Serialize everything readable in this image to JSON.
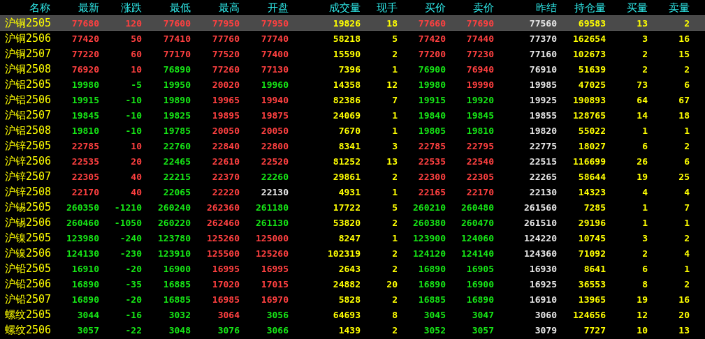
{
  "table": {
    "columns": [
      {
        "label": "名称",
        "kind": "name"
      },
      {
        "label": "最新",
        "kind": "price"
      },
      {
        "label": "涨跌",
        "kind": "price"
      },
      {
        "label": "最低",
        "kind": "price"
      },
      {
        "label": "最高",
        "kind": "price"
      },
      {
        "label": "开盘",
        "kind": "price"
      },
      {
        "label": "成交量",
        "kind": "volume"
      },
      {
        "label": "现手",
        "kind": "volume"
      },
      {
        "label": "买价",
        "kind": "price"
      },
      {
        "label": "卖价",
        "kind": "price"
      },
      {
        "label": "昨结",
        "kind": "settle"
      },
      {
        "label": "持仓量",
        "kind": "volume"
      },
      {
        "label": "买量",
        "kind": "volume"
      },
      {
        "label": "卖量",
        "kind": "volume"
      }
    ],
    "rows": [
      {
        "selected": true,
        "cells": [
          {
            "text": "沪铜2505"
          },
          {
            "text": "77680",
            "color": "#ff4040"
          },
          {
            "text": "120",
            "color": "#ff4040"
          },
          {
            "text": "77600",
            "color": "#ff4040"
          },
          {
            "text": "77950",
            "color": "#ff4040"
          },
          {
            "text": "77950",
            "color": "#ff4040"
          },
          {
            "text": "19826"
          },
          {
            "text": "18"
          },
          {
            "text": "77660",
            "color": "#ff4040"
          },
          {
            "text": "77690",
            "color": "#ff4040"
          },
          {
            "text": "77560"
          },
          {
            "text": "69583"
          },
          {
            "text": "13"
          },
          {
            "text": "2"
          }
        ]
      },
      {
        "selected": false,
        "cells": [
          {
            "text": "沪铜2506"
          },
          {
            "text": "77420",
            "color": "#ff4040"
          },
          {
            "text": "50",
            "color": "#ff4040"
          },
          {
            "text": "77410",
            "color": "#ff4040"
          },
          {
            "text": "77760",
            "color": "#ff4040"
          },
          {
            "text": "77740",
            "color": "#ff4040"
          },
          {
            "text": "58218"
          },
          {
            "text": "5"
          },
          {
            "text": "77420",
            "color": "#ff4040"
          },
          {
            "text": "77440",
            "color": "#ff4040"
          },
          {
            "text": "77370"
          },
          {
            "text": "162654"
          },
          {
            "text": "3"
          },
          {
            "text": "16"
          }
        ]
      },
      {
        "selected": false,
        "cells": [
          {
            "text": "沪铜2507"
          },
          {
            "text": "77220",
            "color": "#ff4040"
          },
          {
            "text": "60",
            "color": "#ff4040"
          },
          {
            "text": "77170",
            "color": "#ff4040"
          },
          {
            "text": "77520",
            "color": "#ff4040"
          },
          {
            "text": "77400",
            "color": "#ff4040"
          },
          {
            "text": "15590"
          },
          {
            "text": "2"
          },
          {
            "text": "77200",
            "color": "#ff4040"
          },
          {
            "text": "77230",
            "color": "#ff4040"
          },
          {
            "text": "77160"
          },
          {
            "text": "102673"
          },
          {
            "text": "2"
          },
          {
            "text": "15"
          }
        ]
      },
      {
        "selected": false,
        "cells": [
          {
            "text": "沪铜2508"
          },
          {
            "text": "76920",
            "color": "#ff4040"
          },
          {
            "text": "10",
            "color": "#ff4040"
          },
          {
            "text": "76890",
            "color": "#16e616"
          },
          {
            "text": "77260",
            "color": "#ff4040"
          },
          {
            "text": "77130",
            "color": "#ff4040"
          },
          {
            "text": "7396"
          },
          {
            "text": "1"
          },
          {
            "text": "76900",
            "color": "#16e616"
          },
          {
            "text": "76940",
            "color": "#ff4040"
          },
          {
            "text": "76910"
          },
          {
            "text": "51639"
          },
          {
            "text": "2"
          },
          {
            "text": "2"
          }
        ]
      },
      {
        "selected": false,
        "cells": [
          {
            "text": "沪铝2505"
          },
          {
            "text": "19980",
            "color": "#16e616"
          },
          {
            "text": "-5",
            "color": "#16e616"
          },
          {
            "text": "19950",
            "color": "#16e616"
          },
          {
            "text": "20020",
            "color": "#ff4040"
          },
          {
            "text": "19960",
            "color": "#16e616"
          },
          {
            "text": "14358"
          },
          {
            "text": "12"
          },
          {
            "text": "19980",
            "color": "#16e616"
          },
          {
            "text": "19990",
            "color": "#ff4040"
          },
          {
            "text": "19985"
          },
          {
            "text": "47025"
          },
          {
            "text": "73"
          },
          {
            "text": "6"
          }
        ]
      },
      {
        "selected": false,
        "cells": [
          {
            "text": "沪铝2506"
          },
          {
            "text": "19915",
            "color": "#16e616"
          },
          {
            "text": "-10",
            "color": "#16e616"
          },
          {
            "text": "19890",
            "color": "#16e616"
          },
          {
            "text": "19965",
            "color": "#ff4040"
          },
          {
            "text": "19940",
            "color": "#ff4040"
          },
          {
            "text": "82386"
          },
          {
            "text": "7"
          },
          {
            "text": "19915",
            "color": "#16e616"
          },
          {
            "text": "19920",
            "color": "#16e616"
          },
          {
            "text": "19925"
          },
          {
            "text": "190893"
          },
          {
            "text": "64"
          },
          {
            "text": "67"
          }
        ]
      },
      {
        "selected": false,
        "cells": [
          {
            "text": "沪铝2507"
          },
          {
            "text": "19845",
            "color": "#16e616"
          },
          {
            "text": "-10",
            "color": "#16e616"
          },
          {
            "text": "19825",
            "color": "#16e616"
          },
          {
            "text": "19895",
            "color": "#ff4040"
          },
          {
            "text": "19875",
            "color": "#ff4040"
          },
          {
            "text": "24069"
          },
          {
            "text": "1"
          },
          {
            "text": "19840",
            "color": "#16e616"
          },
          {
            "text": "19845",
            "color": "#16e616"
          },
          {
            "text": "19855"
          },
          {
            "text": "128765"
          },
          {
            "text": "14"
          },
          {
            "text": "18"
          }
        ]
      },
      {
        "selected": false,
        "cells": [
          {
            "text": "沪铝2508"
          },
          {
            "text": "19810",
            "color": "#16e616"
          },
          {
            "text": "-10",
            "color": "#16e616"
          },
          {
            "text": "19785",
            "color": "#16e616"
          },
          {
            "text": "20050",
            "color": "#ff4040"
          },
          {
            "text": "20050",
            "color": "#ff4040"
          },
          {
            "text": "7670"
          },
          {
            "text": "1"
          },
          {
            "text": "19805",
            "color": "#16e616"
          },
          {
            "text": "19810",
            "color": "#16e616"
          },
          {
            "text": "19820"
          },
          {
            "text": "55022"
          },
          {
            "text": "1"
          },
          {
            "text": "1"
          }
        ]
      },
      {
        "selected": false,
        "cells": [
          {
            "text": "沪锌2505"
          },
          {
            "text": "22785",
            "color": "#ff4040"
          },
          {
            "text": "10",
            "color": "#ff4040"
          },
          {
            "text": "22760",
            "color": "#16e616"
          },
          {
            "text": "22840",
            "color": "#ff4040"
          },
          {
            "text": "22800",
            "color": "#ff4040"
          },
          {
            "text": "8341"
          },
          {
            "text": "3"
          },
          {
            "text": "22785",
            "color": "#ff4040"
          },
          {
            "text": "22795",
            "color": "#ff4040"
          },
          {
            "text": "22775"
          },
          {
            "text": "18027"
          },
          {
            "text": "6"
          },
          {
            "text": "2"
          }
        ]
      },
      {
        "selected": false,
        "cells": [
          {
            "text": "沪锌2506"
          },
          {
            "text": "22535",
            "color": "#ff4040"
          },
          {
            "text": "20",
            "color": "#ff4040"
          },
          {
            "text": "22465",
            "color": "#16e616"
          },
          {
            "text": "22610",
            "color": "#ff4040"
          },
          {
            "text": "22520",
            "color": "#ff4040"
          },
          {
            "text": "81252"
          },
          {
            "text": "13"
          },
          {
            "text": "22535",
            "color": "#ff4040"
          },
          {
            "text": "22540",
            "color": "#ff4040"
          },
          {
            "text": "22515"
          },
          {
            "text": "116699"
          },
          {
            "text": "26"
          },
          {
            "text": "6"
          }
        ]
      },
      {
        "selected": false,
        "cells": [
          {
            "text": "沪锌2507"
          },
          {
            "text": "22305",
            "color": "#ff4040"
          },
          {
            "text": "40",
            "color": "#ff4040"
          },
          {
            "text": "22215",
            "color": "#16e616"
          },
          {
            "text": "22370",
            "color": "#ff4040"
          },
          {
            "text": "22260",
            "color": "#16e616"
          },
          {
            "text": "29861"
          },
          {
            "text": "2"
          },
          {
            "text": "22300",
            "color": "#ff4040"
          },
          {
            "text": "22305",
            "color": "#ff4040"
          },
          {
            "text": "22265"
          },
          {
            "text": "58644"
          },
          {
            "text": "19"
          },
          {
            "text": "25"
          }
        ]
      },
      {
        "selected": false,
        "cells": [
          {
            "text": "沪锌2508"
          },
          {
            "text": "22170",
            "color": "#ff4040"
          },
          {
            "text": "40",
            "color": "#ff4040"
          },
          {
            "text": "22065",
            "color": "#16e616"
          },
          {
            "text": "22220",
            "color": "#ff4040"
          },
          {
            "text": "22130",
            "color": "#e6e6e6"
          },
          {
            "text": "4931"
          },
          {
            "text": "1"
          },
          {
            "text": "22165",
            "color": "#ff4040"
          },
          {
            "text": "22170",
            "color": "#ff4040"
          },
          {
            "text": "22130"
          },
          {
            "text": "14323"
          },
          {
            "text": "4"
          },
          {
            "text": "4"
          }
        ]
      },
      {
        "selected": false,
        "cells": [
          {
            "text": "沪锡2505"
          },
          {
            "text": "260350",
            "color": "#16e616"
          },
          {
            "text": "-1210",
            "color": "#16e616"
          },
          {
            "text": "260240",
            "color": "#16e616"
          },
          {
            "text": "262360",
            "color": "#ff4040"
          },
          {
            "text": "261180",
            "color": "#16e616"
          },
          {
            "text": "17722"
          },
          {
            "text": "5"
          },
          {
            "text": "260210",
            "color": "#16e616"
          },
          {
            "text": "260480",
            "color": "#16e616"
          },
          {
            "text": "261560"
          },
          {
            "text": "7285"
          },
          {
            "text": "1"
          },
          {
            "text": "7"
          }
        ]
      },
      {
        "selected": false,
        "cells": [
          {
            "text": "沪锡2506"
          },
          {
            "text": "260460",
            "color": "#16e616"
          },
          {
            "text": "-1050",
            "color": "#16e616"
          },
          {
            "text": "260220",
            "color": "#16e616"
          },
          {
            "text": "262460",
            "color": "#ff4040"
          },
          {
            "text": "261130",
            "color": "#16e616"
          },
          {
            "text": "53820"
          },
          {
            "text": "2"
          },
          {
            "text": "260380",
            "color": "#16e616"
          },
          {
            "text": "260470",
            "color": "#16e616"
          },
          {
            "text": "261510"
          },
          {
            "text": "29196"
          },
          {
            "text": "1"
          },
          {
            "text": "1"
          }
        ]
      },
      {
        "selected": false,
        "cells": [
          {
            "text": "沪镍2505"
          },
          {
            "text": "123980",
            "color": "#16e616"
          },
          {
            "text": "-240",
            "color": "#16e616"
          },
          {
            "text": "123780",
            "color": "#16e616"
          },
          {
            "text": "125260",
            "color": "#ff4040"
          },
          {
            "text": "125000",
            "color": "#ff4040"
          },
          {
            "text": "8247"
          },
          {
            "text": "1"
          },
          {
            "text": "123900",
            "color": "#16e616"
          },
          {
            "text": "124060",
            "color": "#16e616"
          },
          {
            "text": "124220"
          },
          {
            "text": "10745"
          },
          {
            "text": "3"
          },
          {
            "text": "2"
          }
        ]
      },
      {
        "selected": false,
        "cells": [
          {
            "text": "沪镍2506"
          },
          {
            "text": "124130",
            "color": "#16e616"
          },
          {
            "text": "-230",
            "color": "#16e616"
          },
          {
            "text": "123910",
            "color": "#16e616"
          },
          {
            "text": "125500",
            "color": "#ff4040"
          },
          {
            "text": "125260",
            "color": "#ff4040"
          },
          {
            "text": "102319"
          },
          {
            "text": "2"
          },
          {
            "text": "124120",
            "color": "#16e616"
          },
          {
            "text": "124140",
            "color": "#16e616"
          },
          {
            "text": "124360"
          },
          {
            "text": "71092"
          },
          {
            "text": "2"
          },
          {
            "text": "4"
          }
        ]
      },
      {
        "selected": false,
        "cells": [
          {
            "text": "沪铅2505"
          },
          {
            "text": "16910",
            "color": "#16e616"
          },
          {
            "text": "-20",
            "color": "#16e616"
          },
          {
            "text": "16900",
            "color": "#16e616"
          },
          {
            "text": "16995",
            "color": "#ff4040"
          },
          {
            "text": "16995",
            "color": "#ff4040"
          },
          {
            "text": "2643"
          },
          {
            "text": "2"
          },
          {
            "text": "16890",
            "color": "#16e616"
          },
          {
            "text": "16905",
            "color": "#16e616"
          },
          {
            "text": "16930"
          },
          {
            "text": "8641"
          },
          {
            "text": "6"
          },
          {
            "text": "1"
          }
        ]
      },
      {
        "selected": false,
        "cells": [
          {
            "text": "沪铅2506"
          },
          {
            "text": "16890",
            "color": "#16e616"
          },
          {
            "text": "-35",
            "color": "#16e616"
          },
          {
            "text": "16885",
            "color": "#16e616"
          },
          {
            "text": "17020",
            "color": "#ff4040"
          },
          {
            "text": "17015",
            "color": "#ff4040"
          },
          {
            "text": "24882"
          },
          {
            "text": "20"
          },
          {
            "text": "16890",
            "color": "#16e616"
          },
          {
            "text": "16900",
            "color": "#16e616"
          },
          {
            "text": "16925"
          },
          {
            "text": "36553"
          },
          {
            "text": "8"
          },
          {
            "text": "2"
          }
        ]
      },
      {
        "selected": false,
        "cells": [
          {
            "text": "沪铅2507"
          },
          {
            "text": "16890",
            "color": "#16e616"
          },
          {
            "text": "-20",
            "color": "#16e616"
          },
          {
            "text": "16885",
            "color": "#16e616"
          },
          {
            "text": "16985",
            "color": "#ff4040"
          },
          {
            "text": "16970",
            "color": "#ff4040"
          },
          {
            "text": "5828"
          },
          {
            "text": "2"
          },
          {
            "text": "16885",
            "color": "#16e616"
          },
          {
            "text": "16890",
            "color": "#16e616"
          },
          {
            "text": "16910"
          },
          {
            "text": "13965"
          },
          {
            "text": "19"
          },
          {
            "text": "16"
          }
        ]
      },
      {
        "selected": false,
        "cells": [
          {
            "text": "螺纹2505"
          },
          {
            "text": "3044",
            "color": "#16e616"
          },
          {
            "text": "-16",
            "color": "#16e616"
          },
          {
            "text": "3032",
            "color": "#16e616"
          },
          {
            "text": "3064",
            "color": "#ff4040"
          },
          {
            "text": "3056",
            "color": "#16e616"
          },
          {
            "text": "64693"
          },
          {
            "text": "8"
          },
          {
            "text": "3045",
            "color": "#16e616"
          },
          {
            "text": "3047",
            "color": "#16e616"
          },
          {
            "text": "3060"
          },
          {
            "text": "124656"
          },
          {
            "text": "12"
          },
          {
            "text": "20"
          }
        ]
      },
      {
        "selected": false,
        "cells": [
          {
            "text": "螺纹2506"
          },
          {
            "text": "3057",
            "color": "#16e616"
          },
          {
            "text": "-22",
            "color": "#16e616"
          },
          {
            "text": "3048",
            "color": "#16e616"
          },
          {
            "text": "3076",
            "color": "#16e616"
          },
          {
            "text": "3066",
            "color": "#16e616"
          },
          {
            "text": "1439"
          },
          {
            "text": "2"
          },
          {
            "text": "3052",
            "color": "#16e616"
          },
          {
            "text": "3057",
            "color": "#16e616"
          },
          {
            "text": "3079"
          },
          {
            "text": "7727"
          },
          {
            "text": "10"
          },
          {
            "text": "13"
          }
        ]
      }
    ]
  }
}
